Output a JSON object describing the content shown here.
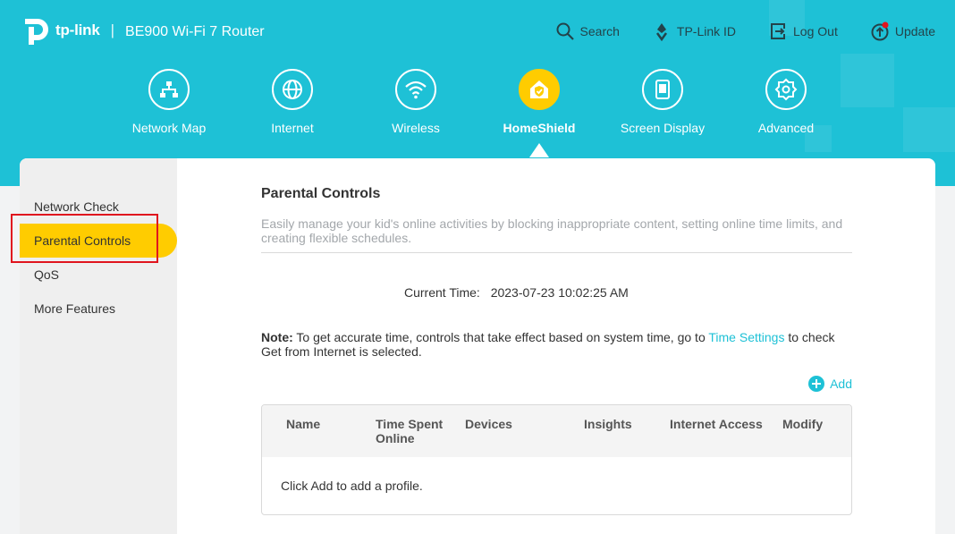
{
  "brand": {
    "logo_text": "tp-link",
    "separator": "|",
    "model": "BE900 Wi-Fi 7 Router"
  },
  "top_actions": [
    {
      "label": "Search",
      "icon": "search-icon"
    },
    {
      "label": "TP-Link ID",
      "icon": "tplink-id-icon"
    },
    {
      "label": "Log Out",
      "icon": "logout-icon"
    },
    {
      "label": "Update",
      "icon": "update-icon"
    }
  ],
  "nav": [
    {
      "label": "Network Map",
      "icon": "network-map-icon"
    },
    {
      "label": "Internet",
      "icon": "globe-icon"
    },
    {
      "label": "Wireless",
      "icon": "wifi-icon"
    },
    {
      "label": "HomeShield",
      "icon": "homeshield-icon",
      "active": true
    },
    {
      "label": "Screen Display",
      "icon": "screen-display-icon"
    },
    {
      "label": "Advanced",
      "icon": "gear-icon"
    }
  ],
  "sidebar": {
    "items": [
      {
        "label": "Network Check"
      },
      {
        "label": "Parental Controls",
        "active": true
      },
      {
        "label": "QoS"
      },
      {
        "label": "More Features"
      }
    ]
  },
  "main": {
    "title": "Parental Controls",
    "description": "Easily manage your kid's online activities by blocking inappropriate content, setting online time limits, and creating flexible schedules.",
    "current_time_label": "Current Time:",
    "current_time_value": "2023-07-23 10:02:25 AM",
    "note_label": "Note:",
    "note_text_1": " To get accurate time, controls that take effect based on system time, go to ",
    "note_link": "Time Settings",
    "note_text_2": " to check Get from Internet is selected.",
    "add_label": "Add",
    "table": {
      "columns": [
        "Name",
        "Time Spent Online",
        "Devices",
        "Insights",
        "Internet Access",
        "Modify"
      ],
      "empty_text": "Click Add to add a profile."
    }
  },
  "colors": {
    "header": "#1ec1d6",
    "accent": "#ffcc00",
    "link": "#1ec1d6",
    "highlight": "#e0141e"
  }
}
